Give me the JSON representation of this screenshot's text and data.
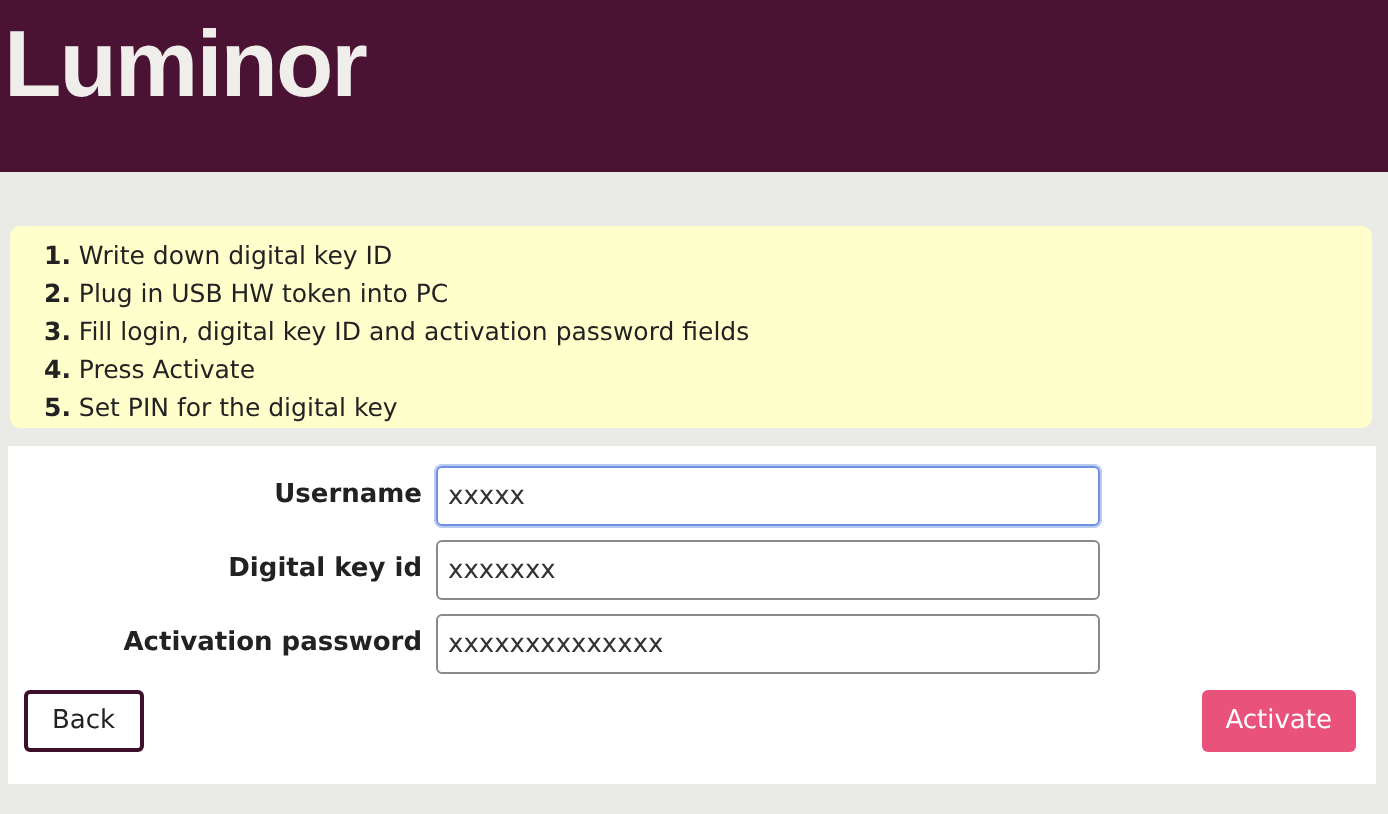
{
  "header": {
    "logo": "Luminor"
  },
  "steps": [
    "**1.** Write down digital key ID",
    "**2.** Plug in USB HW token into PC",
    "**3.** Fill login, digital key ID and activation password fields",
    "**4.** Press Activate",
    "**5.** Set PIN for the digital key"
  ],
  "fields": [
    {
      "label": "Username",
      "value": "xxxxx",
      "focused": true
    },
    {
      "label": "Digital key id",
      "value": "xxxxxxx",
      "focused": false
    },
    {
      "label": "Activation password",
      "value": "xxxxxxxxxxxxxx",
      "focused": false
    }
  ],
  "buttons": [
    {
      "kind": "secondary",
      "label": "Back"
    },
    {
      "kind": "primary",
      "label": "Activate"
    }
  ]
}
